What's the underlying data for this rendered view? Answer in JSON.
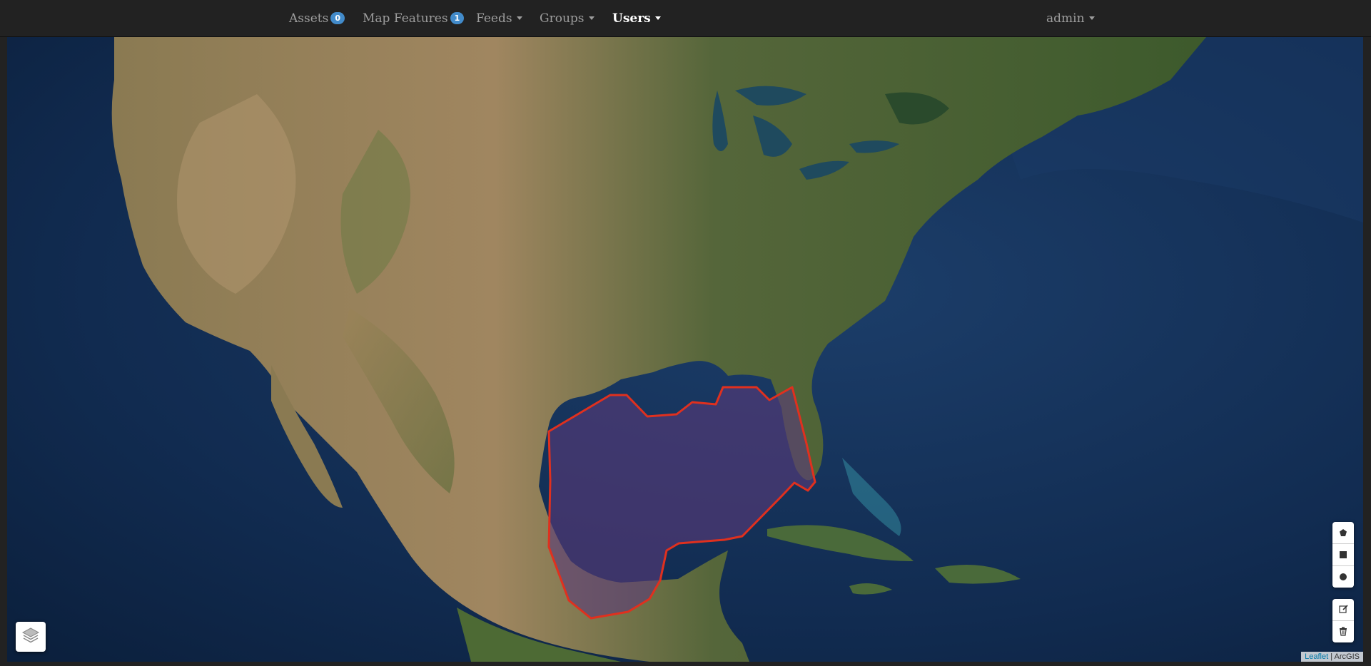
{
  "navbar": {
    "items": [
      {
        "label": "Assets",
        "badge": "0"
      },
      {
        "label": "Map Features",
        "badge": "1"
      },
      {
        "label": "Feeds"
      },
      {
        "label": "Groups"
      },
      {
        "label": "Users"
      }
    ],
    "user": {
      "label": "admin"
    }
  },
  "map": {
    "basemap": "satellite imagery",
    "feature": {
      "type": "polygon",
      "region": "Gulf of Mexico",
      "stroke_color": "#e0301e",
      "fill_color": "#5a3a7a"
    },
    "controls": {
      "layers_icon": "layers-icon",
      "draw_tools": [
        "polygon-icon",
        "rectangle-icon",
        "circle-icon"
      ],
      "edit_tools": [
        "edit-icon",
        "trash-icon"
      ]
    },
    "attribution": {
      "leaflet": "Leaflet",
      "separator": " | ",
      "source": "ArcGIS"
    }
  }
}
